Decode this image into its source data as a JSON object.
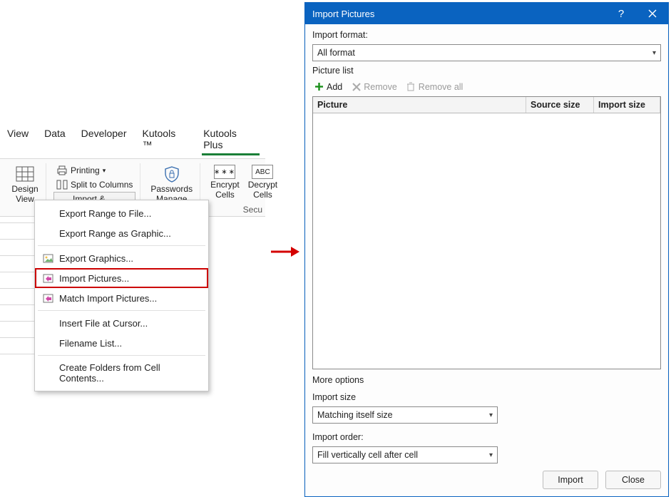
{
  "ribbon": {
    "tabs": [
      "View",
      "Data",
      "Developer",
      "Kutools ™",
      "Kutools Plus"
    ],
    "active_tab": "Kutools Plus",
    "design_view": "Design\nView",
    "printing": "Printing",
    "split_cols": "Split to Columns",
    "imp_exp": "Import & Export",
    "passwords": "Passwords\nManage",
    "encrypt": "Encrypt\nCells",
    "decrypt": "Decrypt\nCells",
    "group_label": "Secu"
  },
  "dropdown": {
    "items": [
      "Export Range to File...",
      "Export Range as Graphic...",
      "Export Graphics...",
      "Import Pictures...",
      "Match Import Pictures...",
      "Insert File at Cursor...",
      "Filename List...",
      "Create Folders from Cell Contents..."
    ],
    "highlight_index": 3
  },
  "dialog": {
    "title": "Import Pictures",
    "import_format_label": "Import format:",
    "import_format_value": "All format",
    "picture_list_label": "Picture list",
    "tool_add": "Add",
    "tool_remove": "Remove",
    "tool_remove_all": "Remove all",
    "col_picture": "Picture",
    "col_source_size": "Source size",
    "col_import_size": "Import size",
    "more_options": "More options",
    "import_size_label": "Import size",
    "import_size_value": "Matching itself size",
    "import_order_label": "Import order:",
    "import_order_value": "Fill vertically cell after cell",
    "btn_import": "Import",
    "btn_close": "Close"
  }
}
